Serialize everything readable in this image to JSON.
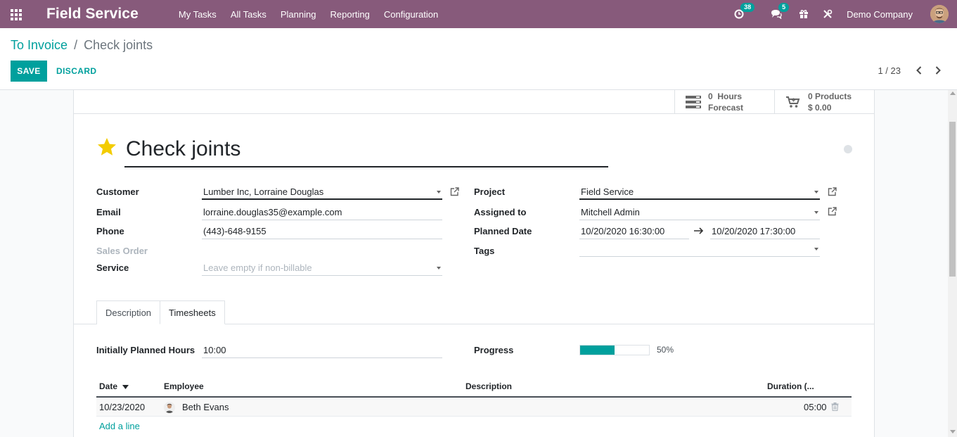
{
  "app": {
    "name": "Field Service",
    "menu": [
      "My Tasks",
      "All Tasks",
      "Planning",
      "Reporting",
      "Configuration"
    ],
    "activity_count": "38",
    "message_count": "5",
    "company": "Demo Company",
    "accent_color": "#875a7b",
    "primary_color": "#00a09d"
  },
  "breadcrumb": {
    "parent": "To Invoice",
    "separator": "/",
    "current": "Check joints"
  },
  "actions": {
    "save": "SAVE",
    "discard": "DISCARD"
  },
  "pager": {
    "value": "1 / 23"
  },
  "smart_buttons": {
    "hours_value": "0",
    "hours_label": "Hours",
    "hours_sub": "Forecast",
    "products_label": "0 Products",
    "products_amount": "$ 0.00"
  },
  "task": {
    "title": "Check joints",
    "priority_icon": "star-icon",
    "kanban_state_color": "#dee2e6"
  },
  "fields": {
    "customer_label": "Customer",
    "customer_value": "Lumber Inc, Lorraine Douglas",
    "email_label": "Email",
    "email_value": "lorraine.douglas35@example.com",
    "phone_label": "Phone",
    "phone_value": "(443)-648-9155",
    "sales_order_label": "Sales Order",
    "service_label": "Service",
    "service_placeholder": "Leave empty if non-billable",
    "project_label": "Project",
    "project_value": "Field Service",
    "assigned_label": "Assigned to",
    "assigned_value": "Mitchell Admin",
    "planned_label": "Planned Date",
    "planned_start": "10/20/2020 16:30:00",
    "planned_end": "10/20/2020 17:30:00",
    "tags_label": "Tags"
  },
  "tabs": {
    "description": "Description",
    "timesheets": "Timesheets",
    "active": "Timesheets"
  },
  "timesheets": {
    "planned_hours_label": "Initially Planned Hours",
    "planned_hours_value": "10:00",
    "progress_label": "Progress",
    "progress_percent": 50,
    "progress_text": "50%",
    "columns": {
      "date": "Date",
      "employee": "Employee",
      "description": "Description",
      "duration": "Duration (..."
    },
    "rows": [
      {
        "date": "10/23/2020",
        "employee": "Beth Evans",
        "description": "",
        "duration": "05:00"
      }
    ],
    "add_line": "Add a line"
  }
}
